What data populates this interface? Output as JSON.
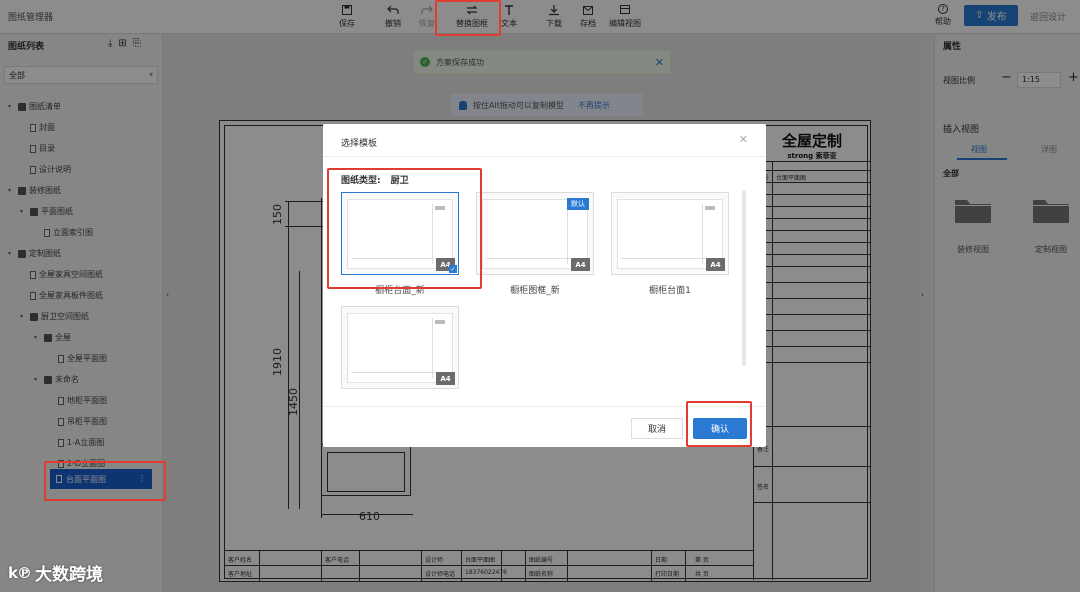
{
  "header": {
    "app_title": "图纸管理器",
    "tools": [
      {
        "label": "保存",
        "icon": "save-icon"
      },
      {
        "label": "撤销",
        "icon": "undo-icon"
      },
      {
        "label": "恢复",
        "icon": "redo-icon"
      },
      {
        "label": "替换图框",
        "icon": "swap-icon"
      },
      {
        "label": "文本",
        "icon": "text-icon"
      },
      {
        "label": "下载",
        "icon": "download-icon"
      },
      {
        "label": "存档",
        "icon": "archive-icon"
      },
      {
        "label": "编辑视图",
        "icon": "edit-view-icon"
      }
    ],
    "help": "帮助",
    "publish": "发布",
    "return": "返回设计"
  },
  "left_panel": {
    "title": "图纸列表",
    "filter": "全部",
    "tree": [
      {
        "label": "图纸清单",
        "level": 0,
        "type": "folder",
        "expanded": true
      },
      {
        "label": "封面",
        "level": 1,
        "type": "doc"
      },
      {
        "label": "目录",
        "level": 1,
        "type": "doc"
      },
      {
        "label": "设计说明",
        "level": 1,
        "type": "doc"
      },
      {
        "label": "装修图纸",
        "level": 0,
        "type": "folder",
        "expanded": true
      },
      {
        "label": "平面图纸",
        "level": 1,
        "type": "folder",
        "expanded": true
      },
      {
        "label": "立面索引图",
        "level": 2,
        "type": "doc"
      },
      {
        "label": "定制图纸",
        "level": 0,
        "type": "folder",
        "expanded": true
      },
      {
        "label": "全屋家具空间图纸",
        "level": 1,
        "type": "doc"
      },
      {
        "label": "全屋家具板件图纸",
        "level": 1,
        "type": "doc"
      },
      {
        "label": "厨卫空间图纸",
        "level": 1,
        "type": "folder",
        "expanded": true
      },
      {
        "label": "全屋",
        "level": 2,
        "type": "folder",
        "expanded": true
      },
      {
        "label": "全屋平面图",
        "level": 3,
        "type": "doc"
      },
      {
        "label": "未命名",
        "level": 2,
        "type": "folder",
        "expanded": true
      },
      {
        "label": "地柜平面图",
        "level": 3,
        "type": "doc"
      },
      {
        "label": "吊柜平面图",
        "level": 3,
        "type": "doc"
      },
      {
        "label": "1-A立面图",
        "level": 3,
        "type": "doc"
      },
      {
        "label": "2-D立面图",
        "level": 3,
        "type": "doc"
      }
    ],
    "selected": "台面平面图"
  },
  "watermark": {
    "logo": "k℗",
    "text": "大数跨境"
  },
  "canvas": {
    "toast": "方案保存成功",
    "hint": "按住Alt拖动可以复制模型",
    "hint_link": "不再提示",
    "brand_main": "全屋定制",
    "brand_sub": "strong",
    "brand_cn": "索菲亚",
    "dims": {
      "d150": "150",
      "d1910": "1910",
      "d1450": "1450",
      "d610": "610"
    },
    "title_block": {
      "owner_name": "客户姓名",
      "owner_addr": "客户地址",
      "owner_phone": "客户电话",
      "design": "设计师",
      "design_phone": "设计师电话",
      "drawing_no": "图纸编号",
      "project": "图纸名称",
      "scale": "比例",
      "date": "日期",
      "print_date": "打印日期",
      "page": "第 页",
      "total": "共 页",
      "row_a": "台面平面图",
      "row_b": "18376022476"
    },
    "side_labels": [
      "图号",
      "台面平面图",
      "备注",
      "签名"
    ]
  },
  "right_panel": {
    "title": "属性",
    "scale_label": "视图比例",
    "scale_value": "1:15",
    "insert_title": "插入视图",
    "tabs": [
      "视图",
      "详图"
    ],
    "all": "全部",
    "items": [
      {
        "label": "装修视图",
        "icon": "folder-icon"
      },
      {
        "label": "定制视图",
        "icon": "folder-icon"
      }
    ]
  },
  "dialog": {
    "title": "选择模板",
    "type_label": "图纸类型:",
    "type_value": "厨卫",
    "templates": [
      {
        "name": "橱柜台面_新",
        "size": "A4",
        "selected": true,
        "default": false
      },
      {
        "name": "橱柜图框_新",
        "size": "A4",
        "selected": false,
        "default": true,
        "badge": "默认"
      },
      {
        "name": "橱柜台面1",
        "size": "A4",
        "selected": false,
        "default": false
      },
      {
        "name": "",
        "size": "A4",
        "selected": false,
        "default": false
      }
    ],
    "cancel": "取消",
    "confirm": "确认"
  },
  "colors": {
    "primary": "#2a7ad3",
    "highlight": "#e03c31",
    "success": "#52b35b"
  }
}
